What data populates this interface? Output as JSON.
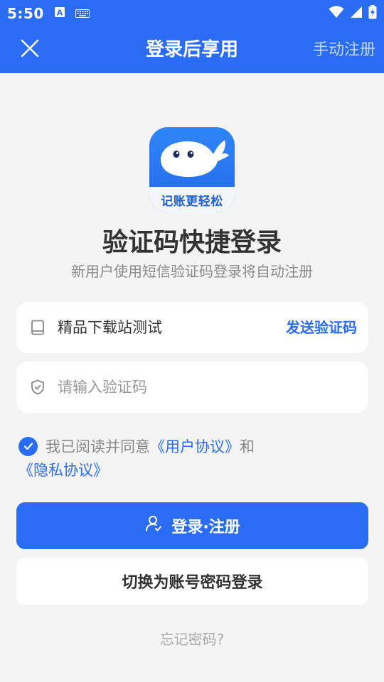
{
  "status_bar": {
    "time": "5:50",
    "icons": [
      "keyboard-a-icon",
      "keyboard-icon",
      "wifi-icon",
      "signal-icon",
      "battery-icon"
    ]
  },
  "nav": {
    "title": "登录后享用",
    "manual_register": "手动注册"
  },
  "app": {
    "icon_caption": "记账更轻松"
  },
  "heading": {
    "title": "验证码快捷登录",
    "subtitle": "新用户使用短信验证码登录将自动注册"
  },
  "phone_field": {
    "value": "精品下载站测试",
    "send_code_label": "发送验证码"
  },
  "code_field": {
    "placeholder": "请输入验证码"
  },
  "agreement": {
    "prefix": "我已阅读并同意",
    "user_agreement": "《用户协议》",
    "and": "和",
    "privacy_agreement": "《隐私协议》",
    "checked": true
  },
  "buttons": {
    "login_register": "登录·注册",
    "switch_password": "切换为账号密码登录",
    "forgot_password": "忘记密码?"
  },
  "colors": {
    "primary": "#2a6df4",
    "background": "#f4f4f4",
    "card": "#ffffff"
  }
}
